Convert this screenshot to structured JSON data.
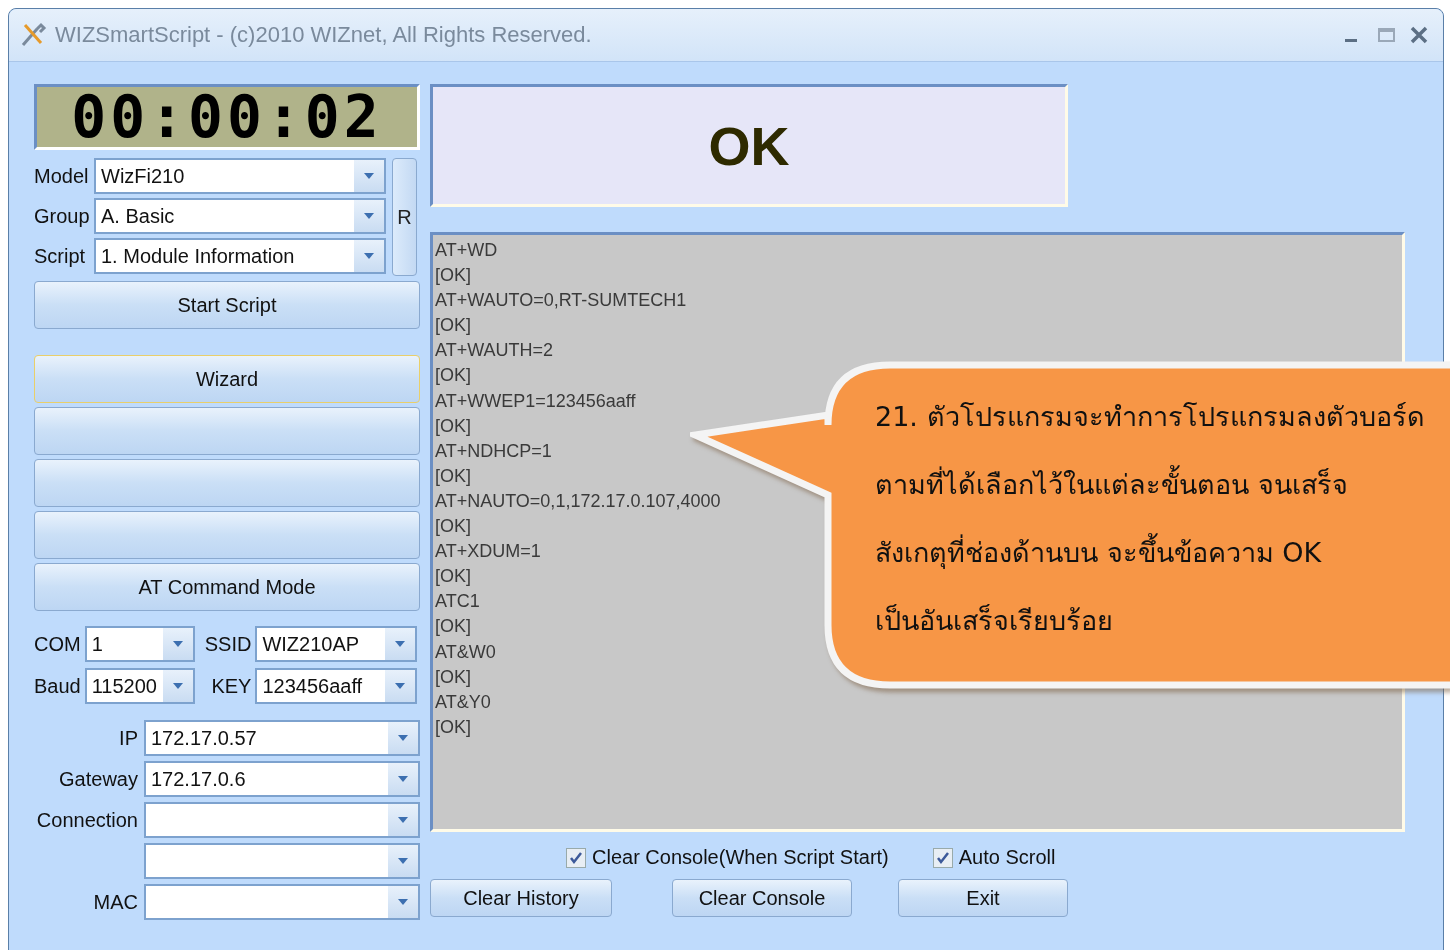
{
  "window": {
    "title": "WIZSmartScript - (c)2010 WIZnet, All Rights Reserved."
  },
  "timer": "00:00:02",
  "selectors": [
    {
      "label": "Model",
      "value": "WizFi210"
    },
    {
      "label": "Group",
      "value": "A. Basic"
    },
    {
      "label": "Script",
      "value": "1. Module Information"
    }
  ],
  "refresh_button": "R",
  "start_button": "Start Script",
  "action_buttons": [
    {
      "kind": "labeled",
      "label": "Wizard",
      "focused": true
    },
    {
      "kind": "blank"
    },
    {
      "kind": "blank"
    },
    {
      "kind": "blank"
    },
    {
      "kind": "labeled",
      "label": "AT Command Mode",
      "focused": false
    }
  ],
  "serial": [
    {
      "label": "COM",
      "value": "1"
    },
    {
      "label": "Baud",
      "value": "115200"
    }
  ],
  "wifi": [
    {
      "label": "SSID",
      "value": "WIZ210AP"
    },
    {
      "label": "KEY",
      "value": "123456aaff"
    }
  ],
  "network": [
    {
      "kind": "labeled",
      "label": "IP",
      "value": "172.17.0.57"
    },
    {
      "kind": "labeled",
      "label": "Gateway",
      "value": "172.17.0.6"
    },
    {
      "kind": "labeled",
      "label": "Connection"
    },
    {
      "kind": "blank"
    },
    {
      "kind": "labeled",
      "label": "MAC"
    }
  ],
  "status": "OK",
  "console": [
    "AT+WD",
    "[OK]",
    "AT+WAUTO=0,RT-SUMTECH1",
    "[OK]",
    "AT+WAUTH=2",
    "[OK]",
    "AT+WWEP1=123456aaff",
    "[OK]",
    "AT+NDHCP=1",
    "[OK]",
    "AT+NAUTO=0,1,172.17.0.107,4000",
    "[OK]",
    "AT+XDUM=1",
    "[OK]",
    "ATC1",
    "[OK]",
    "AT&W0",
    "[OK]",
    "AT&Y0",
    "[OK]"
  ],
  "options": [
    {
      "label": "Clear Console(When Script Start)",
      "checked": true
    },
    {
      "label": "Auto Scroll",
      "checked": true
    }
  ],
  "buttons": [
    "Clear History",
    "Clear Console",
    "Exit"
  ],
  "callout": {
    "lines": [
      "21. ตัวโปรแกรมจะทำการโปรแกรมลงตัวบอร์ด",
      "ตามที่ได้เลือกไว้ในแต่ละขั้นตอน จนเสร็จ",
      "สังเกตุที่ช่องด้านบน จะขึ้นข้อความ OK",
      "เป็นอันเสร็จเรียบร้อย"
    ]
  }
}
